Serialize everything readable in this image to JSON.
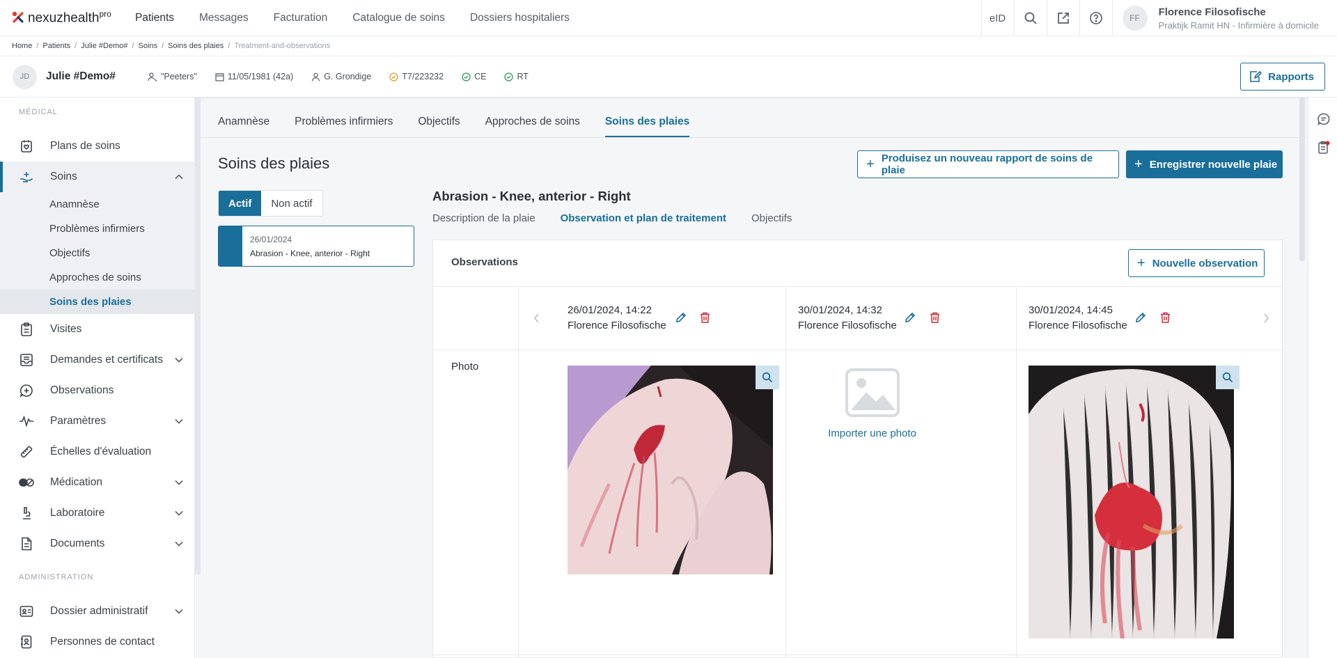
{
  "app": {
    "logo_text": "nexuzhealth",
    "logo_sup": "pro"
  },
  "topnav": {
    "links": [
      "Patients",
      "Messages",
      "Facturation",
      "Catalogue de soins",
      "Dossiers hospitaliers"
    ],
    "eid_label": "eID",
    "icons": [
      "search-icon",
      "external-link-icon",
      "help-icon"
    ]
  },
  "user": {
    "initials": "FF",
    "name": "Florence Filosofische",
    "practice": "Praktijk Ramit HN - Infirmière à domicile"
  },
  "breadcrumb": [
    "Home",
    "Patients",
    "Julie #Demo#",
    "Soins",
    "Soins des plaies",
    "Treatment-and-observations"
  ],
  "patient": {
    "initials": "JD",
    "name": "Julie #Demo#",
    "alias": "\"Peeters\"",
    "dob": "11/05/1981 (42a)",
    "doctor": "G. Grondige",
    "insurance": "T7/223232",
    "ce": "CE",
    "rt": "RT",
    "reports_label": "Rapports"
  },
  "sidebar": {
    "section_medical": "MÉDICAL",
    "items": [
      {
        "label": "Plans de soins",
        "icon": "care-plan-icon"
      },
      {
        "label": "Soins",
        "icon": "care-hand-icon",
        "expanded": true
      },
      {
        "label": "Visites",
        "icon": "clipboard-icon"
      },
      {
        "label": "Demandes et certificats",
        "icon": "inbox-icon"
      },
      {
        "label": "Observations",
        "icon": "chat-plus-icon"
      },
      {
        "label": "Paramètres",
        "icon": "pulse-icon"
      },
      {
        "label": "Échelles d'évaluation",
        "icon": "ruler-icon"
      },
      {
        "label": "Médication",
        "icon": "pills-icon"
      },
      {
        "label": "Laboratoire",
        "icon": "microscope-icon"
      },
      {
        "label": "Documents",
        "icon": "document-icon"
      }
    ],
    "sub_items": [
      "Anamnèse",
      "Problèmes infirmiers",
      "Objectifs",
      "Approches de soins",
      "Soins des plaies"
    ],
    "section_admin": "ADMINISTRATION",
    "admin_items": [
      {
        "label": "Dossier administratif",
        "icon": "id-card-icon"
      },
      {
        "label": "Personnes de contact",
        "icon": "contact-book-icon"
      }
    ]
  },
  "tabs": [
    "Anamnèse",
    "Problèmes infirmiers",
    "Objectifs",
    "Approches de soins",
    "Soins des plaies"
  ],
  "wound_care": {
    "title": "Soins des plaies",
    "new_report_label": "Produisez un nouveau rapport de soins de plaie",
    "new_wound_label": "Enregistrer nouvelle plaie",
    "toggle_active": "Actif",
    "toggle_inactive": "Non actif",
    "wound_card": {
      "date": "26/01/2024",
      "name": "Abrasion - Knee, anterior - Right"
    }
  },
  "wound_detail": {
    "title": "Abrasion - Knee, anterior - Right",
    "subtabs": [
      "Description de la plaie",
      "Observation et plan de traitement",
      "Objectifs"
    ],
    "observations_title": "Observations",
    "new_observation_label": "Nouvelle observation",
    "observations": [
      {
        "date": "26/01/2024, 14:22",
        "author": "Florence Filosofische"
      },
      {
        "date": "30/01/2024, 14:32",
        "author": "Florence Filosofische"
      },
      {
        "date": "30/01/2024, 14:45",
        "author": "Florence Filosofische"
      }
    ],
    "photo_label": "Photo",
    "import_photo_label": "Importer une photo"
  },
  "colors": {
    "accent": "#1a6e9a",
    "danger": "#d3232f",
    "ok": "#2e9b5a",
    "warn": "#e89a2c"
  }
}
